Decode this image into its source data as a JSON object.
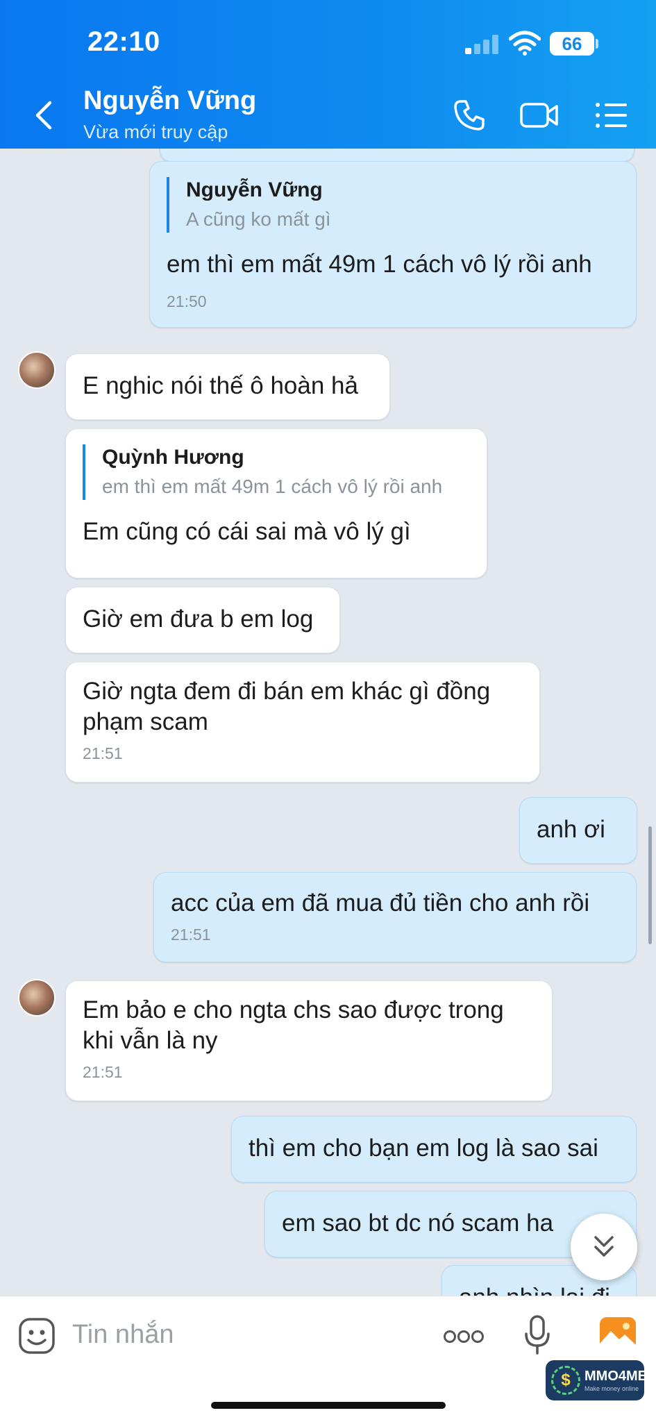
{
  "status_bar": {
    "time": "22:10",
    "battery": "66"
  },
  "header": {
    "contact_name": "Nguyễn Vững",
    "contact_status": "Vừa mới truy cập",
    "icons": [
      "back-chevron-icon",
      "phone-icon",
      "video-camera-icon",
      "list-menu-icon"
    ]
  },
  "messages": {
    "m1": {
      "direction": "out",
      "quote_name": "Nguyễn Vững",
      "quote_text": "A cũng ko mất gì",
      "text": "em thì em mất 49m 1 cách vô lý rồi anh",
      "time": "21:50"
    },
    "m2": {
      "direction": "in",
      "text": "E nghic nói thế ô hoàn hả"
    },
    "m3": {
      "direction": "in",
      "quote_name": "Quỳnh Hương",
      "quote_text": "em thì em mất 49m 1 cách vô lý rồi anh",
      "text": "Em cũng có cái sai mà vô lý gì"
    },
    "m4": {
      "direction": "in",
      "text": "Giờ em đưa b em log"
    },
    "m5": {
      "direction": "in",
      "line1": "Giờ ngta đem đi bán em khác gì đồng",
      "line2": "phạm scam",
      "time": "21:51"
    },
    "m6": {
      "direction": "out",
      "text": "anh ơi"
    },
    "m7": {
      "direction": "out",
      "text": "acc của em đã mua đủ tiền cho anh rồi",
      "time": "21:51"
    },
    "m8": {
      "direction": "in",
      "line1": "Em bảo e cho ngta chs sao được trong",
      "line2": "khi vẫn là ny",
      "time": "21:51"
    },
    "m9": {
      "direction": "out",
      "text": "thì em cho bạn em log là sao sai"
    },
    "m10": {
      "direction": "out",
      "text": "em sao bt dc nó scam ha"
    },
    "m11": {
      "direction": "out",
      "text": "anh nhìn lại đi"
    }
  },
  "input_bar": {
    "placeholder": "Tin nhắn",
    "icons": [
      "sticker-icon",
      "more-options-icon",
      "microphone-icon",
      "image-gallery-icon"
    ]
  },
  "watermark": {
    "title": "MMO4ME",
    "subtitle": "Make money online",
    "logo_glyph": "$"
  },
  "colors": {
    "header": "#0a77f0",
    "outgoing_bubble": "#d4ecfb",
    "incoming_bubble": "#ffffff",
    "background": "#e3e8ef",
    "accent": "#1a86e8"
  }
}
